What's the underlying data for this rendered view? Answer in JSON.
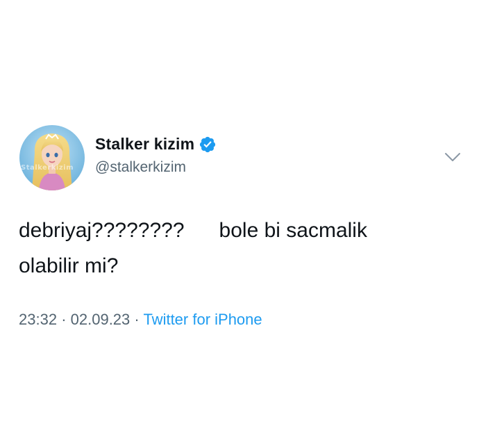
{
  "tweet": {
    "author": {
      "display_name": "Stalker kizim",
      "handle": "@stalkerkizim",
      "verified": true,
      "avatar_watermark": "Stalkerkizim"
    },
    "text": "debriyaj????????      bole bi sacmalik\nolabilir mi?",
    "time": "23:32",
    "separator": "·",
    "date": "02.09.23",
    "source": "Twitter for iPhone"
  },
  "colors": {
    "text": "#0f1419",
    "secondary": "#536471",
    "accent": "#1d9bf0"
  },
  "icons": {
    "verified": "verified-badge-icon",
    "menu": "chevron-down-icon"
  }
}
